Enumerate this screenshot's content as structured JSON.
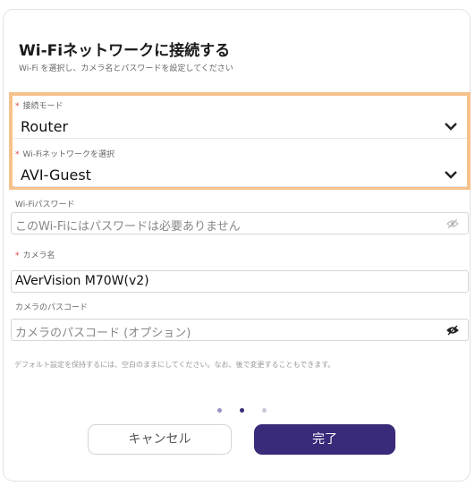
{
  "dialog": {
    "title": "Wi-Fiネットワークに接続する",
    "subtitle": "Wi-Fi を選択し、カメラ名とパスワードを設定してください"
  },
  "fields": {
    "connection_mode": {
      "label": "接続モード",
      "required_mark": "*",
      "value": "Router"
    },
    "wifi_network": {
      "label": "Wi-Fiネットワークを選択",
      "required_mark": "*",
      "value": "AVI-Guest"
    },
    "wifi_password": {
      "label": "Wi-Fiパスワード",
      "placeholder": "このWi-Fiにはパスワードは必要ありません"
    },
    "camera_name": {
      "label": "カメラ名",
      "required_mark": "*",
      "value": "AVerVision M70W(v2)"
    },
    "camera_passcode": {
      "label": "カメラのパスコード",
      "placeholder": "カメラのパスコード (オプション)"
    }
  },
  "helper_text": "デフォルト設定を保持するには、空白のままにしてください。なお、後で変更することもできます。",
  "pagination": {
    "total": 3,
    "active": 2
  },
  "buttons": {
    "cancel": "キャンセル",
    "done": "完了"
  },
  "colors": {
    "highlight_border": "#f5c28b",
    "primary_button": "#3b2a7a",
    "required_mark": "#e53935",
    "dot_active": "#3b2a7a",
    "dot_inactive": "#c8c8d8"
  },
  "icons": {
    "select_indicator": "chevron-down-icon",
    "password_visibility": "eye-icon"
  }
}
